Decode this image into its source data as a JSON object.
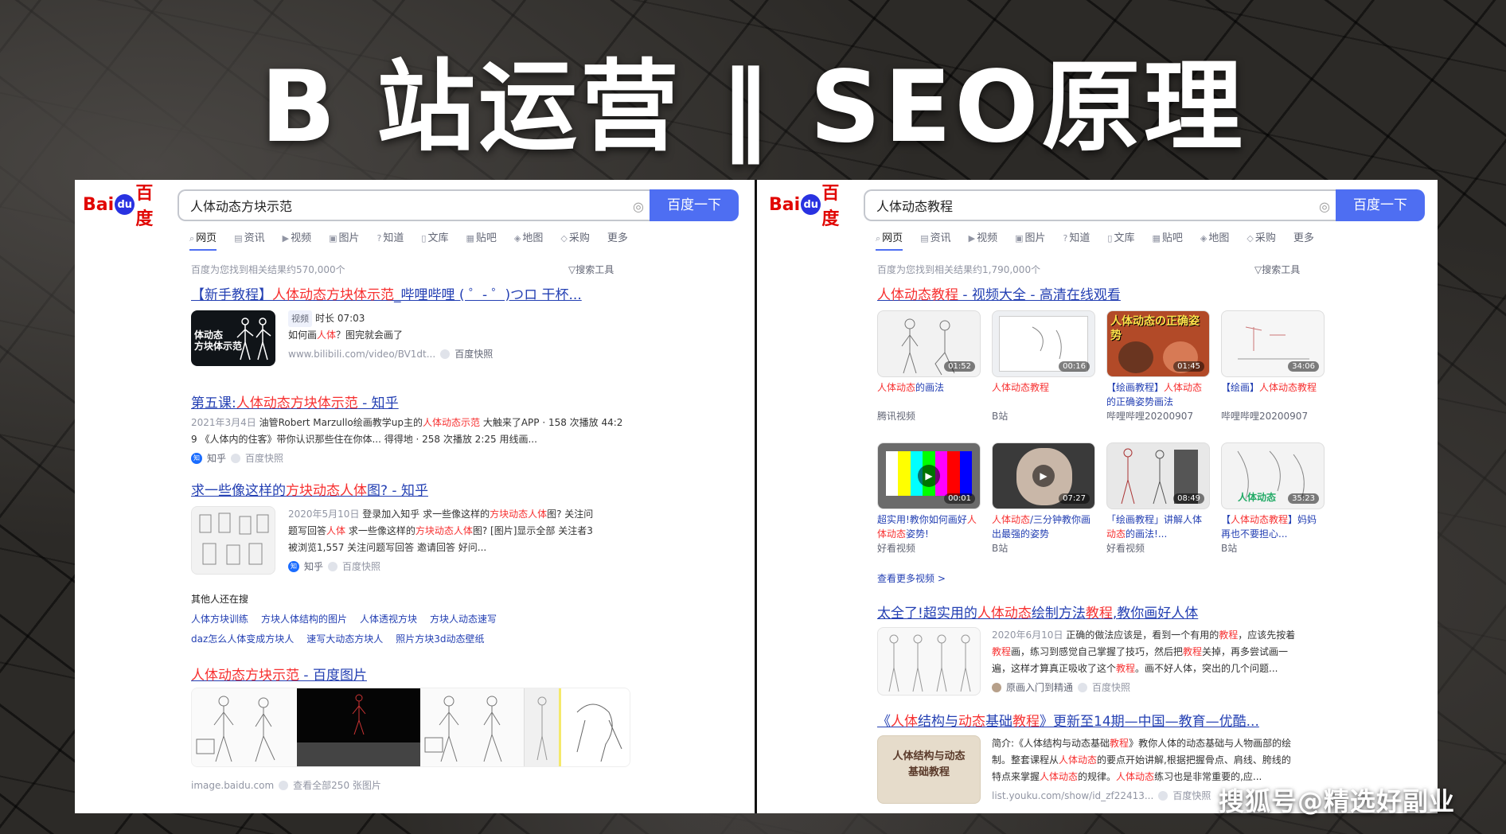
{
  "page": {
    "title": "B 站运营 ‖ SEO原理",
    "watermark": "搜狐号@精选好副业"
  },
  "left": {
    "logo": "Bai百度",
    "query": "人体动态方块示范",
    "search_button": "百度一下",
    "tabs": [
      "网页",
      "资讯",
      "视频",
      "图片",
      "知道",
      "文库",
      "贴吧",
      "地图",
      "采购",
      "更多"
    ],
    "stats": "百度为您找到相关结果约570,000个",
    "tools": "搜索工具",
    "r1": {
      "title_a": "【新手教程】",
      "title_b": "人体动态方块体示范",
      "title_c": "_哔哩哔哩 ( ゜- ゜)つロ 干杯...",
      "tag": "视频",
      "duration": "时长 07:03",
      "desc_a": "如何画",
      "desc_b": "人体",
      "desc_c": "？图完就会画了",
      "url": "www.bilibili.com/video/BV1dt...",
      "snapshot": "百度快照",
      "thumb_text": "体动态\n方块体示范"
    },
    "r2": {
      "title_a": "第五课:",
      "title_b": "人体动态方块体示范",
      "title_c": " - 知乎",
      "line1_a": "2021年3月4日",
      "line1_b": " 油管Robert Marzullo绘画教学up主的",
      "line1_c": "人体动态示范",
      "line1_d": " 大触来了APP · 158 次播放 44:2",
      "line2": "9 《人体内的住客》带你认识那些住在你体... 得得地 · 258 次播放 2:25 用线画...",
      "source": "知乎",
      "snapshot": "百度快照"
    },
    "r3": {
      "title_a": "求一些像这样的",
      "title_b": "方块动态人体",
      "title_c": "图? - 知乎",
      "l1_a": "2020年5月10日",
      "l1_b": " 登录加入知乎 求一些像这样的",
      "l1_c": "方块动态人体",
      "l1_d": "图? 关注问",
      "l2_a": "题写回答",
      "l2_b": "人体",
      "l2_c": " 求一些像这样的",
      "l2_d": "方块动态人体",
      "l2_e": "图? [图片]显示全部  关注者3",
      "l3": "被浏览1,557 关注问题写回答 邀请回答 好问...",
      "source": "知乎",
      "snapshot": "百度快照"
    },
    "also": {
      "heading": "其他人还在搜",
      "row1": [
        "人体方块训练",
        "方块人体结构的图片",
        "人体透视方块",
        "方块人动态速写"
      ],
      "row2": [
        "daz怎么人体变成方块人",
        "速写大动态方块人",
        "照片方块3d动态壁纸"
      ]
    },
    "r4": {
      "title_a": "人体动态方块示范",
      "title_b": " - 百度图片",
      "url": "image.baidu.com",
      "all": "查看全部250 张图片"
    }
  },
  "right": {
    "logo": "Bai百度",
    "query": "人体动态教程",
    "search_button": "百度一下",
    "tabs": [
      "网页",
      "资讯",
      "视频",
      "图片",
      "知道",
      "文库",
      "贴吧",
      "地图",
      "采购",
      "更多"
    ],
    "stats": "百度为您找到相关结果约1,790,000个",
    "tools": "搜索工具",
    "r1": {
      "title_a": "人体动态教程",
      "title_b": " - 视频大全 - 高清在线观看"
    },
    "videos_row1": [
      {
        "dur": "01:52",
        "cap_a": "人体动态",
        "cap_b": "的画法",
        "cap_c": "",
        "src": "腾讯视频",
        "color": "#f2f2f2"
      },
      {
        "dur": "00:16",
        "cap_a": "人体动态教程",
        "cap_b": "",
        "cap_c": "",
        "src": "B站",
        "color": "#eef0f3"
      },
      {
        "dur": "01:45",
        "cap_a": "【绘画教程】",
        "cap_b": "人体动态",
        "cap_c": "的正确姿势画法",
        "src": "哔哩哔哩20200907",
        "color": "#b24a28",
        "thumb_text": "人体动态の正确姿势"
      },
      {
        "dur": "34:06",
        "cap_a": "【绘画】",
        "cap_b": "人体动态教程",
        "cap_c": "",
        "src": "哔哩哔哩20200907",
        "color": "#f6f6f6"
      }
    ],
    "videos_row2": [
      {
        "dur": "00:01",
        "cap_a": "超实用!教你如何画好",
        "cap_b": "人体动态",
        "cap_c": "姿势!",
        "src": "好看视频",
        "color": "#6b6b6b"
      },
      {
        "dur": "07:27",
        "cap_a": "人体动态",
        "cap_b": "/三分钟教你画出最强的姿势",
        "cap_c": "",
        "src": "B站",
        "color": "#3a3a3a"
      },
      {
        "dur": "08:49",
        "cap_a": "「绘画教程」讲解人体",
        "cap_b": "动态",
        "cap_c": "的画法!...",
        "src": "好看视频",
        "color": "#e8e8e8"
      },
      {
        "dur": "35:23",
        "cap_a": "【",
        "cap_b": "人体动态教程",
        "cap_c": "】妈妈再也不要担心...",
        "src": "B站",
        "color": "#f3f3f3",
        "thumb_text": "人体动态"
      }
    ],
    "more_videos": "查看更多视频 >",
    "r2": {
      "title_a": "太全了!超实用的",
      "title_b": "人体动态",
      "title_c": "绘制方法",
      "title_d": "教程",
      "title_e": ",教你画好人体",
      "l1_a": "2020年6月10日",
      "l1_b": " 正确的做法应该是，看到一个有用的",
      "l1_c": "教程",
      "l1_d": "，应该先按着",
      "l2_a": "教程",
      "l2_b": "画，练习到感觉自己掌握了技巧，然后把",
      "l2_c": "教程",
      "l2_d": "关掉，再多尝试画一",
      "l3_a": "遍，这样才算真正吸收了这个",
      "l3_b": "教程",
      "l3_c": "。画不好人体，突出的几个问题...",
      "source": "原画入门到精通",
      "snapshot": "百度快照"
    },
    "r3": {
      "title_a": "《",
      "title_b": "人体",
      "title_c": "结构与",
      "title_d": "动态",
      "title_e": "基础",
      "title_f": "教程",
      "title_g": "》更新至14期—中国—教育—优酷...",
      "l1_a": "简介:《人体结构与动态基础",
      "l1_b": "教程",
      "l1_c": "》教你人体的动态基础与人物画部的绘",
      "l2_a": "制。整套课程从",
      "l2_b": "人体动态",
      "l2_c": "的要点开始讲解,根据把握骨点、肩线、胯线的",
      "l3_a": "特点来掌握",
      "l3_b": "人体动态",
      "l3_c": "的规律。",
      "l3_d": "人体动态",
      "l3_e": "练习也是非常重要的,应...",
      "url": "list.youku.com/show/id_zf22413...",
      "snapshot": "百度快照",
      "thumb_text": "人体结构与动态\n基础教程"
    }
  }
}
